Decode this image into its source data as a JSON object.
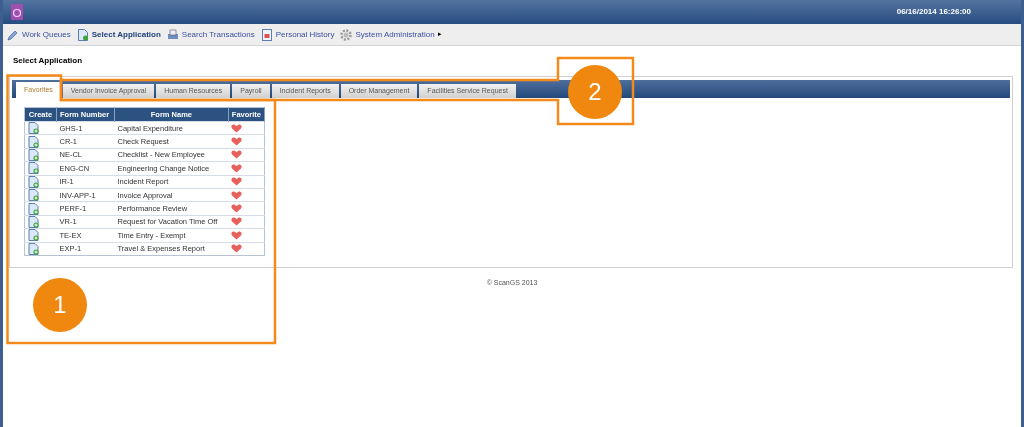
{
  "header": {
    "timestamp": "06/16/2014 16:26:00"
  },
  "menu": [
    {
      "label": "Work Queues",
      "selected": false
    },
    {
      "label": "Select Application",
      "selected": true
    },
    {
      "label": "Search Transactions",
      "selected": false
    },
    {
      "label": "Personal History",
      "selected": false
    },
    {
      "label": "System Administration",
      "selected": false,
      "submenu": "▸"
    }
  ],
  "page_title": "Select Application",
  "tabs": [
    {
      "label": "Favorites",
      "selected": true
    },
    {
      "label": "Vendor Invoice Approval",
      "selected": false
    },
    {
      "label": "Human Resources",
      "selected": false
    },
    {
      "label": "Payroll",
      "selected": false
    },
    {
      "label": "Incident Reports",
      "selected": false
    },
    {
      "label": "Order Management",
      "selected": false
    },
    {
      "label": "Facilities Service Request",
      "selected": false
    }
  ],
  "table": {
    "columns": [
      "Create",
      "Form Number",
      "Form Name",
      "Favorite"
    ],
    "rows": [
      {
        "form_number": "GHS-1",
        "form_name": "Capital Expenditure"
      },
      {
        "form_number": "CR-1",
        "form_name": "Check Request"
      },
      {
        "form_number": "NE-CL",
        "form_name": "Checklist - New Employee"
      },
      {
        "form_number": "ENG-CN",
        "form_name": "Engineering Change Notice"
      },
      {
        "form_number": "IR-1",
        "form_name": "Incident Report"
      },
      {
        "form_number": "INV-APP-1",
        "form_name": "Invoice Approval"
      },
      {
        "form_number": "PERF-1",
        "form_name": "Performance Review"
      },
      {
        "form_number": "VR-1",
        "form_name": "Request for Vacation Time Off"
      },
      {
        "form_number": "TE-EX",
        "form_name": "Time Entry - Exempt"
      },
      {
        "form_number": "EXP-1",
        "form_name": "Travel & Expenses Report"
      }
    ]
  },
  "footer": "© ScanGS 2013",
  "callouts": [
    "1",
    "2"
  ]
}
